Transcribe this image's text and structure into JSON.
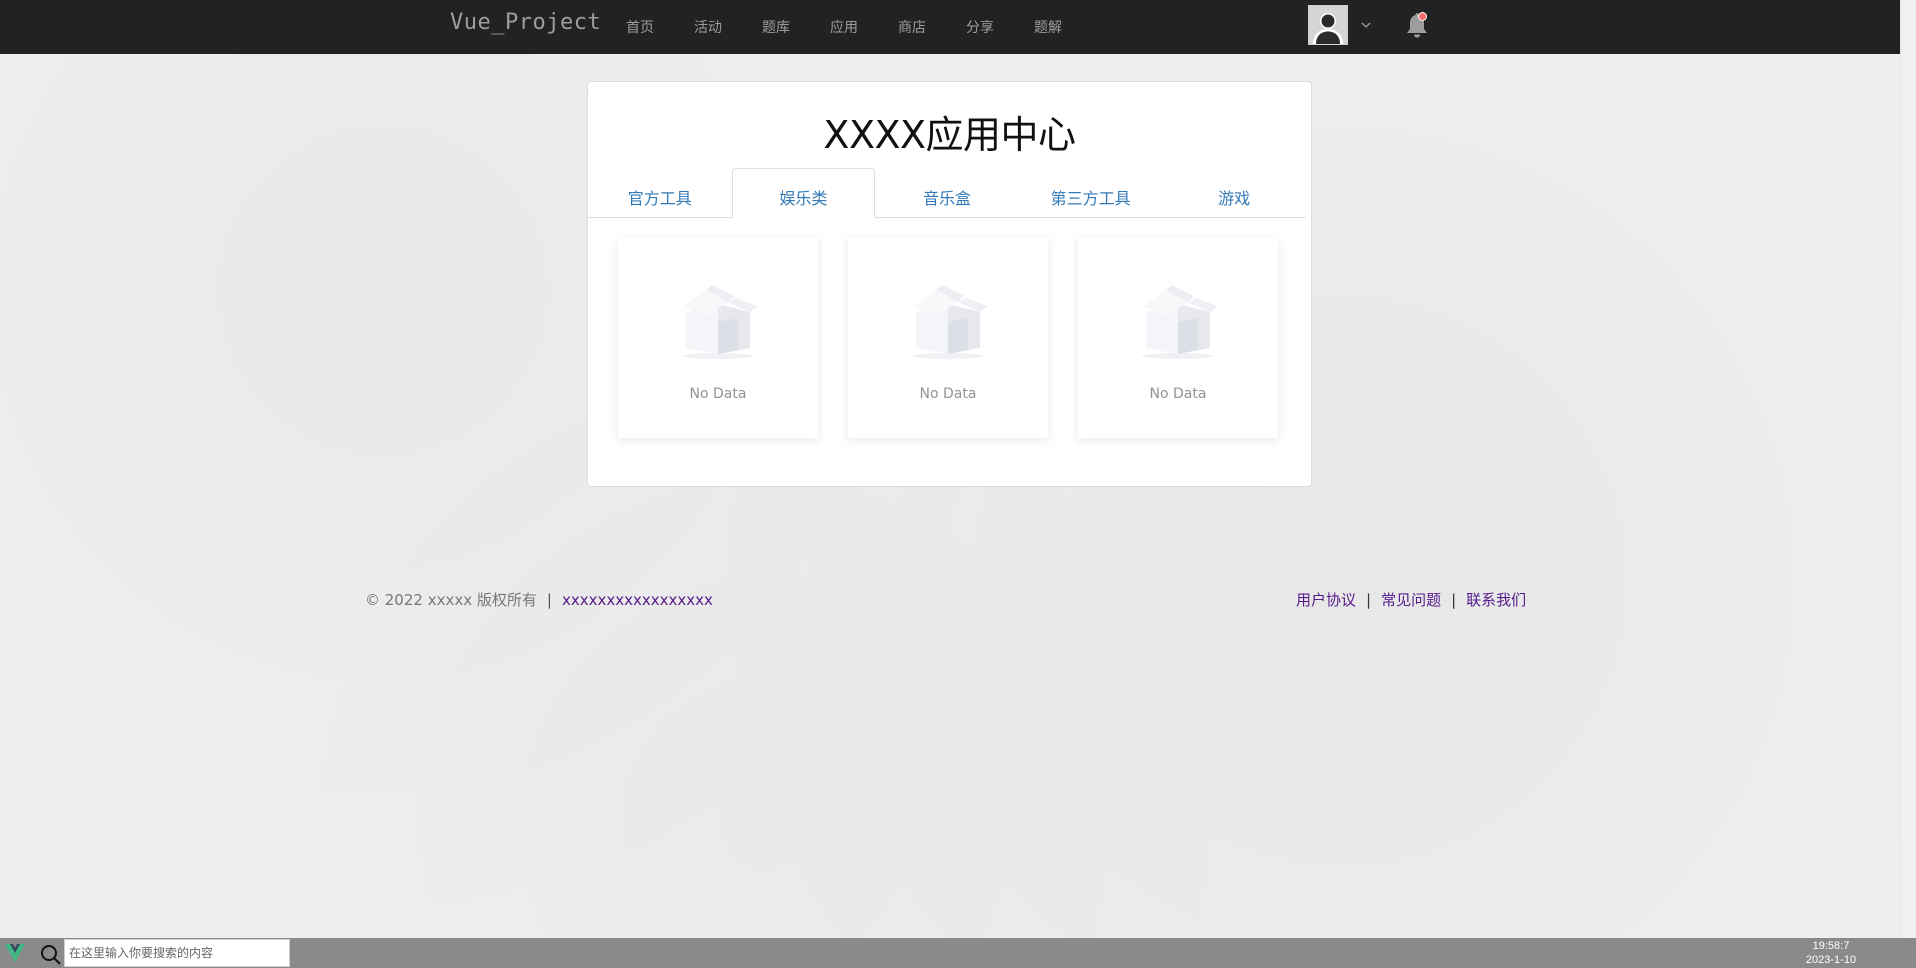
{
  "navbar": {
    "brand": "Vue_Project",
    "links": [
      "首页",
      "活动",
      "题库",
      "应用",
      "商店",
      "分享",
      "题解"
    ],
    "notification_dot_color": "#f56c6c",
    "background_color": "#222222"
  },
  "main": {
    "title": "XXXX应用中心",
    "tabs": [
      {
        "label": "官方工具",
        "active": false
      },
      {
        "label": "娱乐类",
        "active": true
      },
      {
        "label": "音乐盒",
        "active": false
      },
      {
        "label": "第三方工具",
        "active": false
      },
      {
        "label": "游戏",
        "active": false
      }
    ],
    "cards": [
      {
        "empty_text": "No Data"
      },
      {
        "empty_text": "No Data"
      },
      {
        "empty_text": "No Data"
      }
    ]
  },
  "footer": {
    "copyright": "© 2022 xxxxx 版权所有",
    "left_link": "xxxxxxxxxxxxxxxxx",
    "right_links": [
      "用户协议",
      "常见问题",
      "联系我们"
    ],
    "separator": "|"
  },
  "taskbar": {
    "search_placeholder": "在这里输入你要搜索的内容",
    "time": "19:58:7",
    "date": "2023-1-10"
  },
  "colors": {
    "tab_link": "#337ab7",
    "visited_link": "#551a8b",
    "empty_text": "#909399"
  }
}
